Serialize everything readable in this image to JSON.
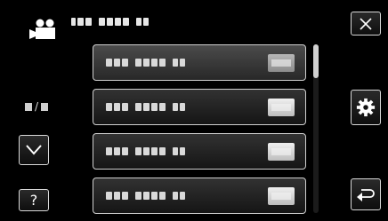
{
  "header": {
    "mode_icon": "video-camera-icon",
    "title_text": ""
  },
  "controls": {
    "close_icon": "close-x-icon",
    "settings_icon": "gear-icon",
    "back_icon": "return-arrow-icon",
    "down_icon": "chevron-down-icon",
    "help_label": "?"
  },
  "page_indicator": {
    "separator": "/"
  },
  "menu": {
    "items": [
      {
        "label": "",
        "value": "",
        "selected": true
      },
      {
        "label": "",
        "value": "",
        "selected": false
      },
      {
        "label": "",
        "value": "",
        "selected": false
      },
      {
        "label": "",
        "value": "",
        "selected": false
      }
    ]
  },
  "scroll": {
    "position_fraction": 0.0,
    "visible_fraction": 0.2
  }
}
